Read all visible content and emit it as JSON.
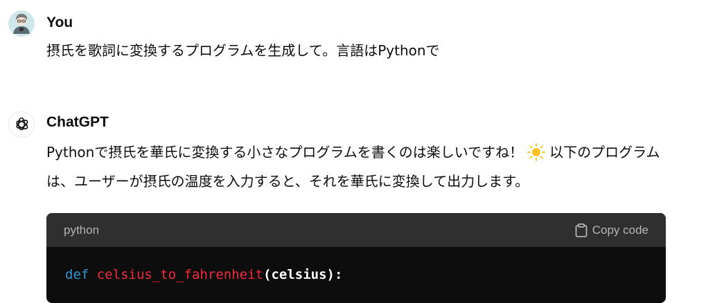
{
  "user_message": {
    "author": "You",
    "text": "摂氏を歌詞に変換するプログラムを生成して。言語はPythonで"
  },
  "assistant_message": {
    "author": "ChatGPT",
    "text_part1": "Pythonで摂氏を華氏に変換する小さなプログラムを書くのは楽しいですね！",
    "emoji_icon": "sun-icon",
    "text_part2": "以下のプログラムは、ユーザーが摂氏の温度を入力すると、それを華氏に変換して出力します。",
    "code_block": {
      "language": "python",
      "copy_label": "Copy code",
      "copy_icon": "clipboard-icon",
      "line1_keyword": "def",
      "line1_function": "celsius_to_fahrenheit",
      "line1_rest": "(celsius):"
    }
  },
  "colors": {
    "code_bg": "#0d0d0d",
    "code_header_bg": "#2f2f2f",
    "keyword": "#2e95d3",
    "function_name": "#f22c3d",
    "header_text": "#b4b4b4"
  }
}
